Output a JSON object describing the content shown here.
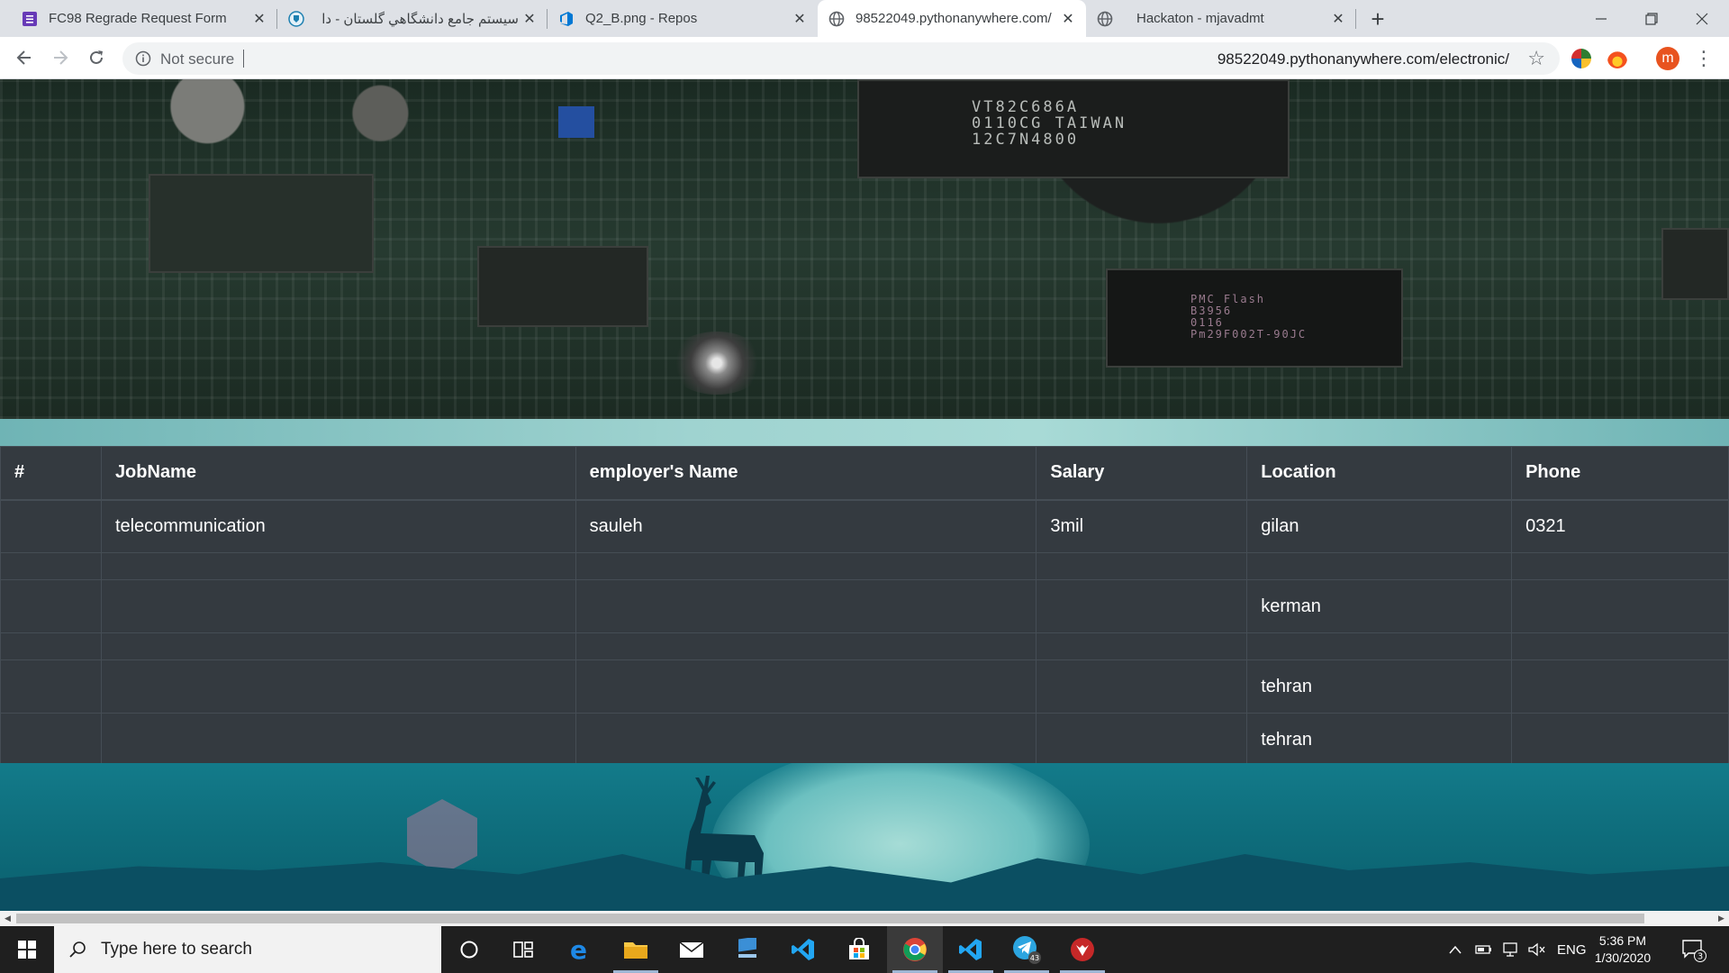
{
  "browser": {
    "tabs": [
      {
        "title": "FC98 Regrade Request Form",
        "icon": "forms-icon",
        "active": false
      },
      {
        "title": "سیستم جامع دانشگاهي گلستان - دا",
        "icon": "golestan-icon",
        "active": false
      },
      {
        "title": "Q2_B.png - Repos",
        "icon": "azure-devops-icon",
        "active": false
      },
      {
        "title": "98522049.pythonanywhere.com/",
        "icon": "globe-icon",
        "active": true
      },
      {
        "title": "Hackaton - mjavadmt",
        "icon": "globe-icon",
        "active": false
      }
    ],
    "security_label": "Not secure",
    "url": "98522049.pythonanywhere.com/electronic/",
    "profile_initial": "m"
  },
  "table": {
    "headers": [
      "#",
      "JobName",
      "employer's Name",
      "Salary",
      "Location",
      "Phone"
    ],
    "rows": [
      {
        "num": "",
        "job": "telecommunication",
        "employer": "sauleh",
        "salary": "3mil",
        "location": "gilan",
        "phone": "0321"
      },
      {
        "num": "",
        "job": "",
        "employer": "",
        "salary": "",
        "location": "",
        "phone": ""
      },
      {
        "num": "",
        "job": "",
        "employer": "",
        "salary": "",
        "location": "kerman",
        "phone": ""
      },
      {
        "num": "",
        "job": "",
        "employer": "",
        "salary": "",
        "location": "",
        "phone": ""
      },
      {
        "num": "",
        "job": "",
        "employer": "",
        "salary": "",
        "location": "tehran",
        "phone": ""
      },
      {
        "num": "",
        "job": "",
        "employer": "",
        "salary": "",
        "location": "tehran",
        "phone": ""
      }
    ]
  },
  "hero_chip_text": {
    "main_chip": [
      "VT82C686A",
      "0110CG TAIWAN",
      "12C7N4800"
    ],
    "flash_chip": [
      "PMC Flash",
      "B3956",
      "0116",
      "Pm29F002T-90JC"
    ]
  },
  "taskbar": {
    "search_placeholder": "Type here to search",
    "apps": [
      "cortana-icon",
      "task-view-icon",
      "edge-icon",
      "file-explorer-icon",
      "mail-icon",
      "app-icon",
      "vscode-icon",
      "store-icon",
      "chrome-icon",
      "vscode-icon",
      "telegram-icon",
      "app-red-icon"
    ],
    "telegram_badge": "43",
    "language": "ENG",
    "time": "5:36 PM",
    "date": "1/30/2020",
    "notification_count": "3"
  },
  "colors": {
    "table_bg": "#343a40",
    "table_border": "#454d55",
    "chrome_tabbar": "#dee1e6",
    "taskbar": "#1f1f1f"
  }
}
